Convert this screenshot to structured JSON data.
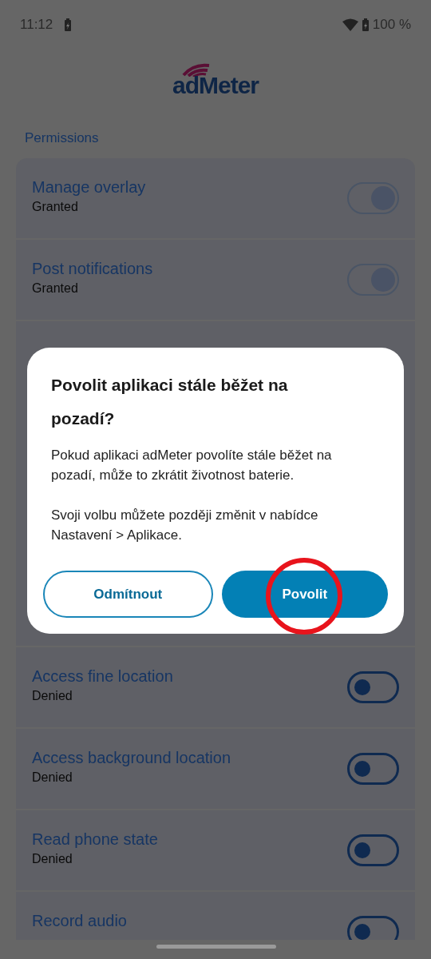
{
  "status_bar": {
    "time": "11:12",
    "battery": "100 %"
  },
  "app": {
    "logo": "adMeter",
    "section_title": "Permissions"
  },
  "permissions_above_dialog": [
    {
      "name": "Manage overlay",
      "status": "Granted",
      "on": true
    },
    {
      "name": "Post notifications",
      "status": "Granted",
      "on": true
    }
  ],
  "permissions_below_dialog": [
    {
      "name": "Access fine location",
      "status": "Denied",
      "on": false
    },
    {
      "name": "Access background location",
      "status": "Denied",
      "on": false
    },
    {
      "name": "Read phone state",
      "status": "Denied",
      "on": false
    },
    {
      "name": "Record audio",
      "on": false
    }
  ],
  "dialog": {
    "title": "Povolit aplikaci stále běžet na pozadí?",
    "paragraphs": [
      "Pokud aplikaci adMeter povolíte stále běžet na pozadí, může to zkrátit životnost baterie.",
      "Svoji volbu můžete později změnit v nabídce Nastavení > Aplikace."
    ],
    "buttons": [
      {
        "label": "Odmítnout",
        "kind": "outlined"
      },
      {
        "label": "Povolit",
        "kind": "filled"
      }
    ]
  }
}
